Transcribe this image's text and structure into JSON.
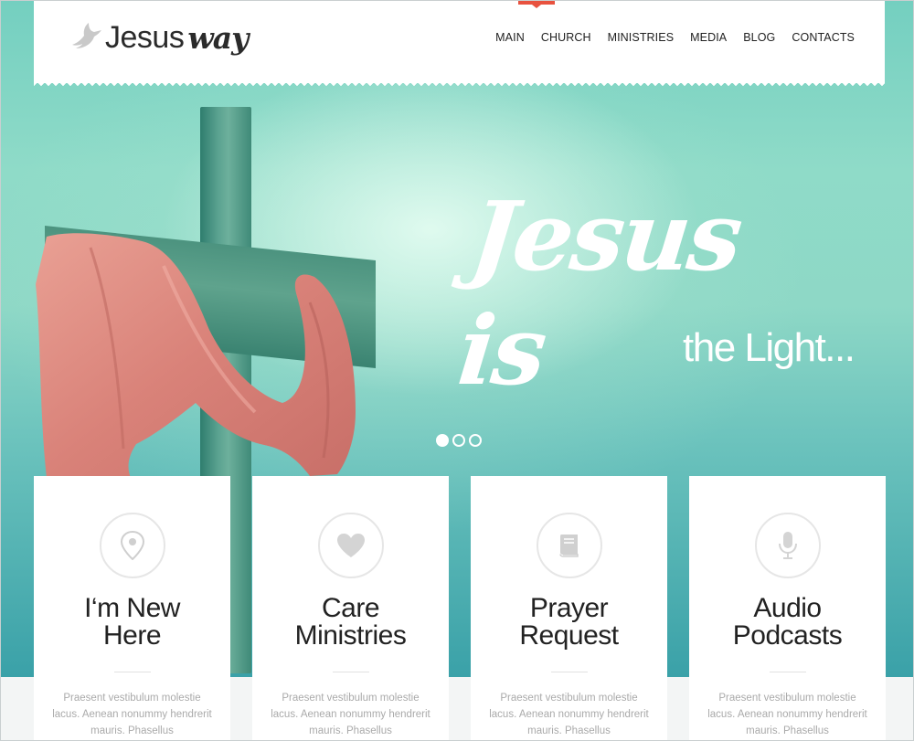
{
  "logo": {
    "part1": "Jesus",
    "part2": "way",
    "icon": "dove-icon"
  },
  "nav": {
    "items": [
      {
        "label": "MAIN"
      },
      {
        "label": "CHURCH"
      },
      {
        "label": "MINISTRIES"
      },
      {
        "label": "MEDIA"
      },
      {
        "label": "BLOG"
      },
      {
        "label": "CONTACTS"
      }
    ],
    "active": "MAIN",
    "accent_color": "#e8523f"
  },
  "hero": {
    "title": "Jesus is",
    "subtitle": "the Light...",
    "slides": 3,
    "active_slide": 1
  },
  "cards": [
    {
      "icon": "map-pin-icon",
      "title_line1": "I‘m New",
      "title_line2": "Here",
      "text": "Praesent vestibulum molestie lacus. Aenean nonummy hendrerit mauris. Phasellus"
    },
    {
      "icon": "heart-icon",
      "title_line1": "Care",
      "title_line2": "Ministries",
      "text": "Praesent vestibulum molestie lacus. Aenean nonummy hendrerit mauris. Phasellus"
    },
    {
      "icon": "book-icon",
      "title_line1": "Prayer",
      "title_line2": "Request",
      "text": "Praesent vestibulum molestie lacus. Aenean nonummy hendrerit mauris. Phasellus"
    },
    {
      "icon": "microphone-icon",
      "title_line1": "Audio",
      "title_line2": "Podcasts",
      "text": "Praesent vestibulum molestie lacus. Aenean nonummy hendrerit mauris. Phasellus"
    }
  ],
  "colors": {
    "hero_teal": "#74cfc0",
    "cloth_pink": "#e08f86",
    "text_dark": "#222222",
    "text_muted": "#aaaaaa"
  }
}
